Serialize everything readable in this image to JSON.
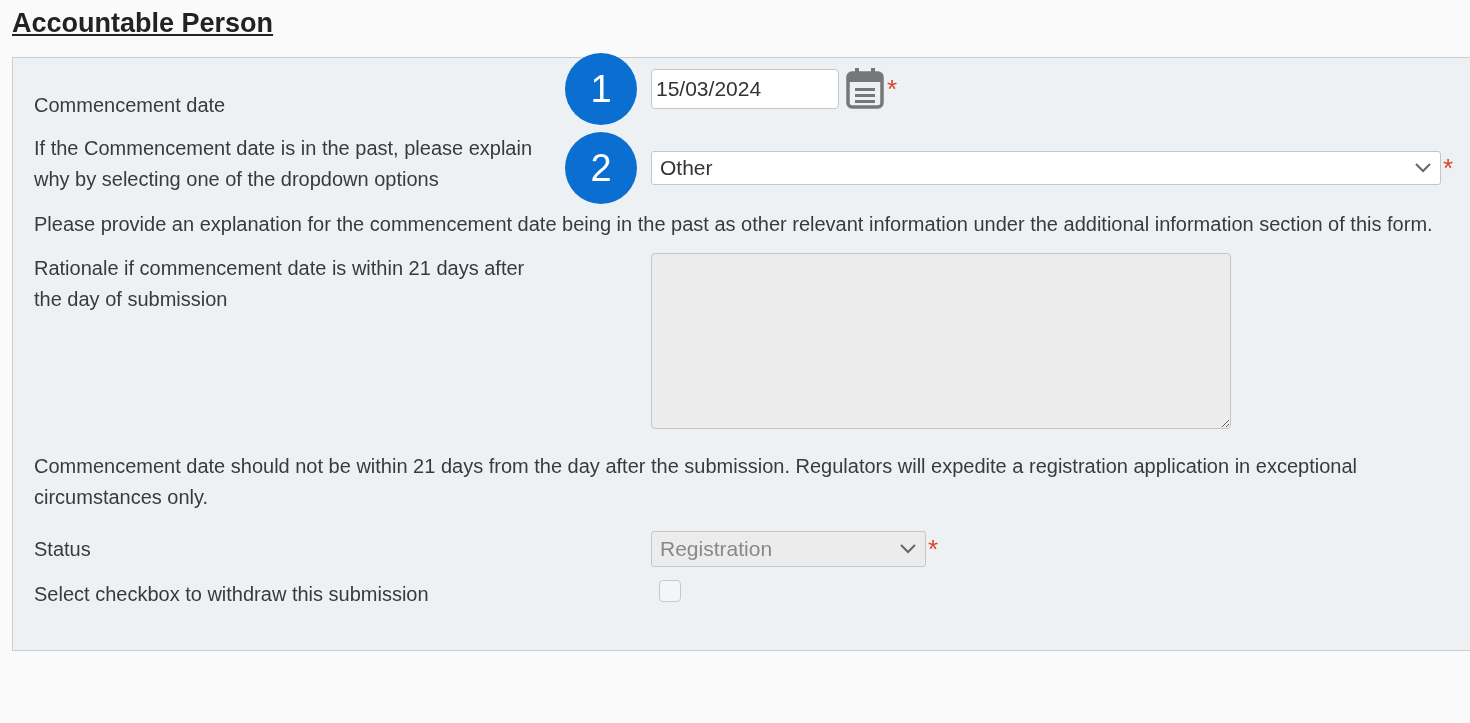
{
  "heading": "Accountable Person",
  "rows": [
    {
      "kind": "date",
      "label": "Commencement date",
      "value": "15/03/2024",
      "required_mark": "*",
      "badge": "1"
    },
    {
      "kind": "wide-select",
      "label": "If the Commencement date is in the past, please explain why by selecting one of the dropdown options",
      "value": "Other",
      "required_mark": "*",
      "disabled": false,
      "badge": "2"
    },
    {
      "kind": "note",
      "label": "Please provide an explanation for the commencement date being in the past as other relevant information under the additional information section of this form."
    },
    {
      "kind": "textarea",
      "label": "Rationale if commencement date is within 21 days after the day of submission",
      "disabled": true
    },
    {
      "kind": "note",
      "label": "Commencement date should not be within 21 days from the day after the submission. Regulators will expedite a registration application in exceptional circumstances only."
    },
    {
      "kind": "select",
      "label": "Status",
      "value": "Registration",
      "required_mark": "*",
      "disabled": true
    },
    {
      "kind": "checkbox",
      "label": "Select checkbox to withdraw this submission",
      "checked": false,
      "disabled": true
    }
  ]
}
